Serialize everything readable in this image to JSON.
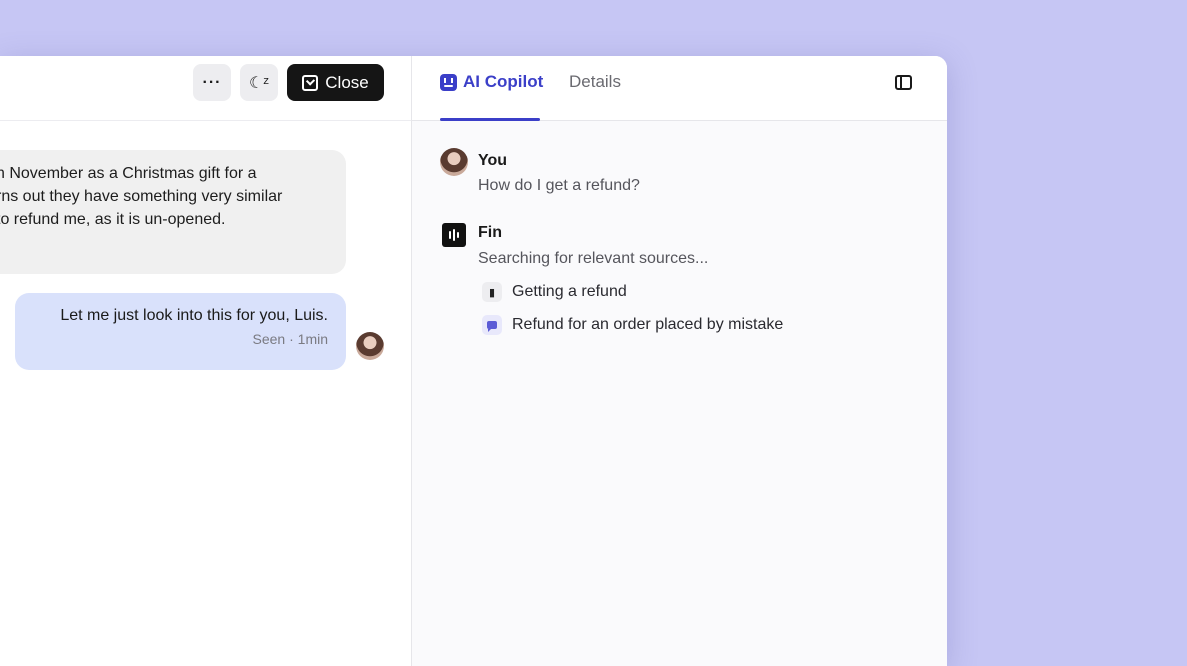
{
  "conversation": {
    "toolbar": {
      "more_label": "···",
      "snooze_label": "☾ᶻ",
      "close_label": "Close"
    },
    "messages": [
      {
        "lines": [
          "n November as a Christmas gift for a",
          "rns out they have something very similar",
          "to refund me, as it is un-opened."
        ]
      },
      {
        "text": "Let me just look into this for you, Luis.",
        "meta": "Seen · 1min"
      }
    ]
  },
  "copilot": {
    "tabs": [
      {
        "label": "AI Copilot"
      },
      {
        "label": "Details"
      }
    ],
    "thread": {
      "you": {
        "name": "You",
        "text": "How do I get a refund?"
      },
      "fin": {
        "name": "Fin",
        "status": "Searching for relevant sources...",
        "sources": [
          {
            "label": "Getting a refund",
            "icon": "book-icon"
          },
          {
            "label": "Refund for an order placed by mistake",
            "icon": "chat-icon"
          }
        ]
      }
    },
    "cursor_glyph": "☝"
  },
  "colors": {
    "background": "#c6c6f4",
    "accent": "#3b3fc8",
    "outgoing_bubble": "#d9e1fb",
    "close_button": "#151515"
  }
}
